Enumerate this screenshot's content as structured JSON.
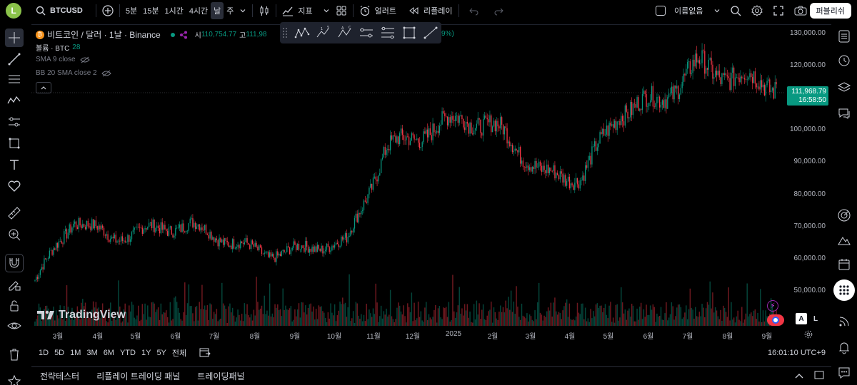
{
  "topbar": {
    "avatar_letter": "L",
    "symbol": "BTCUSD",
    "intervals": [
      "5분",
      "15분",
      "1시간",
      "4시간",
      "날",
      "주"
    ],
    "indicators_label": "지표",
    "alerts_label": "얼러트",
    "replay_label": "리플레이",
    "layout_name": "이름없음",
    "publish_label": "퍼블리쉬"
  },
  "legend": {
    "title": "비트코인 / 달러 · 1날 · Binance",
    "open_key": "시",
    "open_value": "110,754.77",
    "high_key": "고",
    "high_value": "111,98",
    "change_tail": "9%)",
    "volume_label": "볼륨 · BTC",
    "volume_value": "28",
    "sma_label": "SMA 9 close",
    "bb_label": "BB 20 SMA close 2"
  },
  "price_scale": {
    "labels": [
      "130,000.00",
      "120,000.00",
      "100,000.00",
      "90,000.00",
      "80,000.00",
      "70,000.00",
      "60,000.00",
      "50,000.00"
    ],
    "last_price": "111,968.79",
    "last_time": "16:58:50"
  },
  "time_axis": {
    "labels": [
      "3월",
      "4월",
      "5월",
      "6월",
      "7월",
      "8월",
      "9월",
      "10월",
      "11월",
      "12월",
      "2025",
      "2월",
      "3월",
      "4월",
      "5월",
      "6월",
      "7월",
      "8월",
      "9월"
    ]
  },
  "watermark": "TradingView",
  "scale_buttons": {
    "auto": "A",
    "log": "L"
  },
  "range_buttons": [
    "1D",
    "5D",
    "1M",
    "3M",
    "6M",
    "YTD",
    "1Y",
    "5Y",
    "전체"
  ],
  "clock": "16:01:10 UTC+9",
  "bottom_tabs": [
    "전략테스터",
    "리플레이 트레이딩 패널",
    "트레이딩패널"
  ],
  "colors": {
    "up": "#089981",
    "down": "#f23645",
    "background": "#000000",
    "accent": "#2962ff"
  },
  "chart_data": {
    "type": "candlestick",
    "symbol": "BTCUSD",
    "interval": "1D",
    "x_range": [
      "2024-02",
      "2025-09"
    ],
    "ylim": [
      45000,
      130000
    ],
    "approx_closes_by_month": [
      {
        "month": "2024-02",
        "close": 51000
      },
      {
        "month": "2024-03",
        "close": 70000
      },
      {
        "month": "2024-04",
        "close": 64000
      },
      {
        "month": "2024-05",
        "close": 67000
      },
      {
        "month": "2024-06",
        "close": 68000
      },
      {
        "month": "2024-07",
        "close": 63000
      },
      {
        "month": "2024-08",
        "close": 59000
      },
      {
        "month": "2024-09",
        "close": 61000
      },
      {
        "month": "2024-10",
        "close": 63000
      },
      {
        "month": "2024-11",
        "close": 92000
      },
      {
        "month": "2024-12",
        "close": 97000
      },
      {
        "month": "2025-01",
        "close": 102000
      },
      {
        "month": "2025-02",
        "close": 97000
      },
      {
        "month": "2025-03",
        "close": 84000
      },
      {
        "month": "2025-04",
        "close": 83000
      },
      {
        "month": "2025-05",
        "close": 104000
      },
      {
        "month": "2025-06",
        "close": 107000
      },
      {
        "month": "2025-07",
        "close": 118000
      },
      {
        "month": "2025-08",
        "close": 114000
      },
      {
        "month": "2025-09",
        "close": 111968.79
      }
    ],
    "last_price": 111968.79,
    "volume_series": true
  }
}
